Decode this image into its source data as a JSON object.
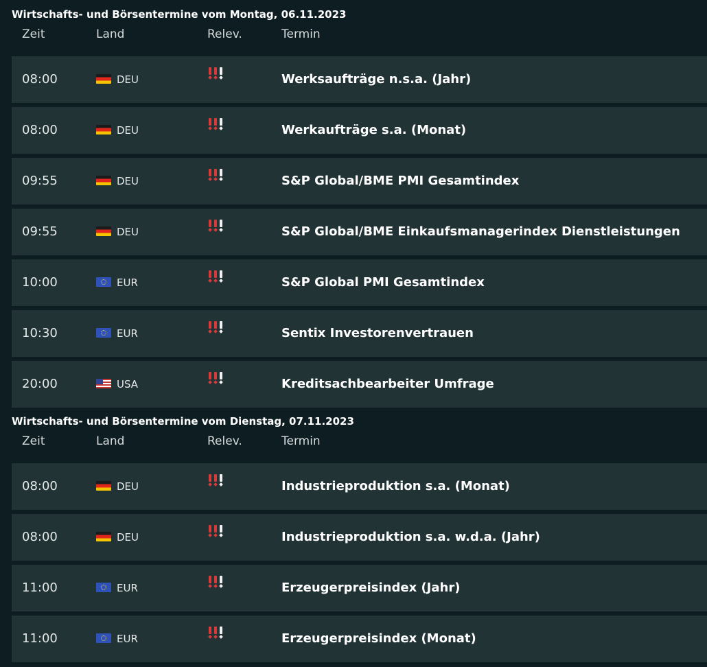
{
  "colors": {
    "background": "#0d1d22",
    "row_background": "#223336",
    "relevance_active": "#d83a3a",
    "relevance_inactive": "#f0f0f0"
  },
  "columns": {
    "time": "Zeit",
    "country": "Land",
    "relevance": "Relev.",
    "event": "Termin"
  },
  "days": [
    {
      "title": "Wirtschafts- und Börsentermine vom Montag, 06.11.2023",
      "events": [
        {
          "time": "08:00",
          "flag": "germany-flag-icon",
          "country": "DEU",
          "relevance": "2 of 3",
          "event": "Werksaufträge n.s.a. (Jahr)"
        },
        {
          "time": "08:00",
          "flag": "germany-flag-icon",
          "country": "DEU",
          "relevance": "2 of 3",
          "event": "Werkaufträge s.a. (Monat)"
        },
        {
          "time": "09:55",
          "flag": "germany-flag-icon",
          "country": "DEU",
          "relevance": "2 of 3",
          "event": "S&P Global/BME PMI Gesamtindex"
        },
        {
          "time": "09:55",
          "flag": "germany-flag-icon",
          "country": "DEU",
          "relevance": "2 of 3",
          "event": "S&P Global/BME Einkaufsmanagerindex Dienstleistungen"
        },
        {
          "time": "10:00",
          "flag": "eu-flag-icon",
          "country": "EUR",
          "relevance": "2 of 3",
          "event": "S&P Global PMI Gesamtindex"
        },
        {
          "time": "10:30",
          "flag": "eu-flag-icon",
          "country": "EUR",
          "relevance": "2 of 3",
          "event": "Sentix Investorenvertrauen"
        },
        {
          "time": "20:00",
          "flag": "usa-flag-icon",
          "country": "USA",
          "relevance": "2 of 3",
          "event": "Kreditsachbearbeiter Umfrage"
        }
      ]
    },
    {
      "title": "Wirtschafts- und Börsentermine vom Dienstag, 07.11.2023",
      "events": [
        {
          "time": "08:00",
          "flag": "germany-flag-icon",
          "country": "DEU",
          "relevance": "2 of 3",
          "event": "Industrieproduktion s.a. (Monat)"
        },
        {
          "time": "08:00",
          "flag": "germany-flag-icon",
          "country": "DEU",
          "relevance": "2 of 3",
          "event": "Industrieproduktion s.a. w.d.a. (Jahr)"
        },
        {
          "time": "11:00",
          "flag": "eu-flag-icon",
          "country": "EUR",
          "relevance": "2 of 3",
          "event": "Erzeugerpreisindex (Jahr)"
        },
        {
          "time": "11:00",
          "flag": "eu-flag-icon",
          "country": "EUR",
          "relevance": "2 of 3",
          "event": "Erzeugerpreisindex (Monat)"
        }
      ]
    }
  ]
}
